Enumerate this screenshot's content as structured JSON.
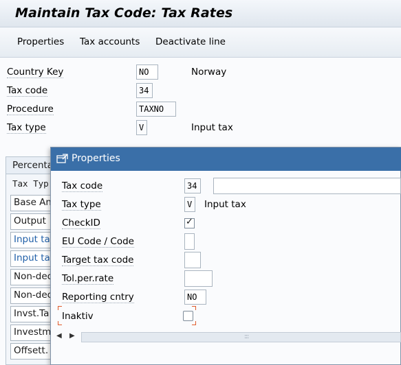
{
  "window": {
    "title": "Maintain Tax Code: Tax Rates"
  },
  "menu": {
    "items": [
      "Properties",
      "Tax accounts",
      "Deactivate line"
    ]
  },
  "header_fields": [
    {
      "label": "Country Key",
      "value": "NO",
      "desc": "Norway"
    },
    {
      "label": "Tax code",
      "value": "34",
      "desc": ""
    },
    {
      "label": "Procedure",
      "value": "TAXNO",
      "desc": ""
    },
    {
      "label": "Tax type",
      "value": "V",
      "desc": "Input tax"
    }
  ],
  "background_table": {
    "tab_label": "Percenta",
    "column_header": "Tax Typ",
    "rows": [
      {
        "label": "Base An",
        "color": "#000000"
      },
      {
        "label": "Output",
        "color": "#000000"
      },
      {
        "label": "Input ta",
        "color": "#1f5fa8"
      },
      {
        "label": "Input ta",
        "color": "#1f5fa8"
      },
      {
        "label": "Non-dec",
        "color": "#000000"
      },
      {
        "label": "Non-dec",
        "color": "#000000"
      },
      {
        "label": "Invst.Ta",
        "color": "#000000"
      },
      {
        "label": "Investm",
        "color": "#000000"
      },
      {
        "label": "Offsett.",
        "color": "#000000"
      }
    ]
  },
  "dialog": {
    "title": "Properties",
    "fields": {
      "tax_code": {
        "label": "Tax code",
        "value": "34",
        "desc": ""
      },
      "tax_type": {
        "label": "Tax type",
        "value": "V",
        "desc": "Input tax"
      },
      "check_id": {
        "label": "CheckID",
        "checked": true
      },
      "eu_code": {
        "label": "EU Code / Code",
        "value": ""
      },
      "target_tax_code": {
        "label": "Target tax code",
        "value": ""
      },
      "tol_per_rate": {
        "label": "Tol.per.rate",
        "value": ""
      },
      "reporting_country": {
        "label": "Reporting cntry",
        "value": "NO"
      },
      "inaktiv": {
        "label": "Inaktiv",
        "checked": false
      }
    },
    "scrollbar_grip": ":::"
  },
  "colors": {
    "dialog_title_bar": "#3a6fa8",
    "focus_marker": "#e05a2a",
    "link_blue": "#1f5fa8"
  }
}
